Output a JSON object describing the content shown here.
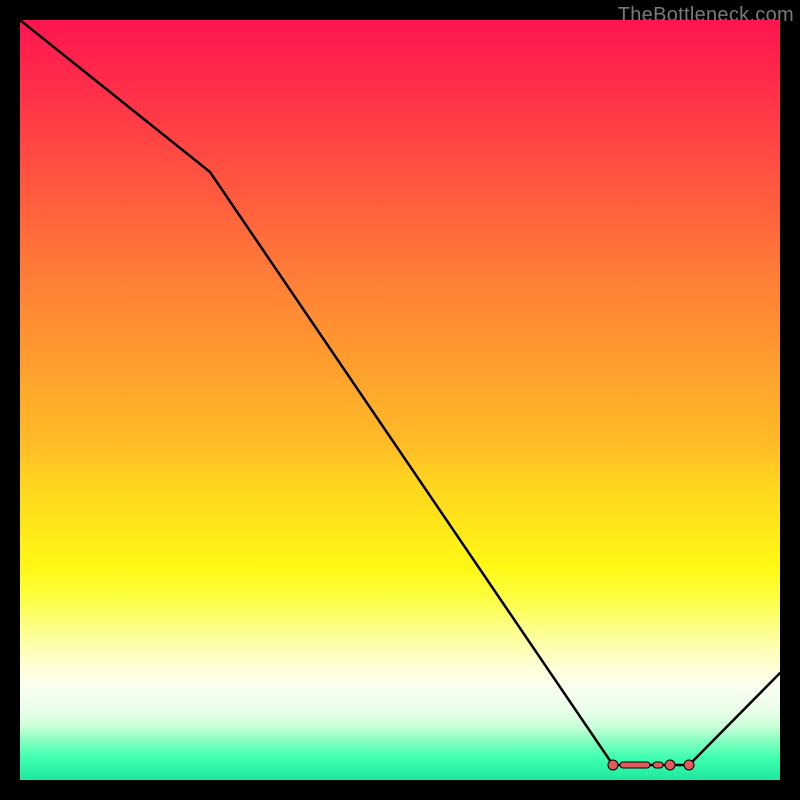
{
  "watermark": "TheBottleneck.com",
  "chart_data": {
    "type": "line",
    "x": [
      0,
      0.25,
      0.78,
      0.88,
      1.0
    ],
    "values": [
      100,
      80,
      2,
      2,
      14
    ],
    "ylim": [
      0,
      100
    ],
    "xlim": [
      0,
      1
    ],
    "title": "",
    "xlabel": "",
    "ylabel": "",
    "markers_x": [
      0.78,
      0.8,
      0.82,
      0.84,
      0.86,
      0.88
    ],
    "markers_y": [
      2,
      2,
      2,
      2,
      2,
      2
    ],
    "background_gradient": [
      "#ff1550",
      "#ffe51a",
      "#1fe89e"
    ]
  }
}
